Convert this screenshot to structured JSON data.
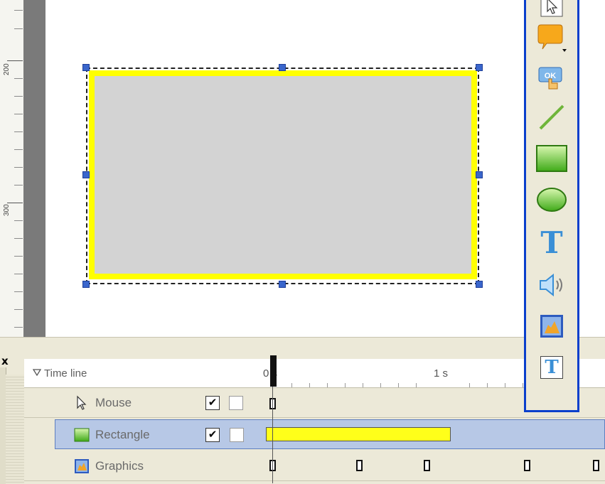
{
  "ruler": {
    "labels": [
      "200",
      "300"
    ]
  },
  "canvas": {
    "shape": {
      "fill": "#d3d3d3",
      "stroke": "#ffff00"
    },
    "handle_color": "#3a66cc"
  },
  "toolbox": {
    "border_color": "#0a3fcc",
    "tools": [
      {
        "name": "select",
        "icon": "arrow-pointer-icon"
      },
      {
        "name": "callout",
        "icon": "speech-bubble-icon"
      },
      {
        "name": "button",
        "icon": "ok-button-click-icon",
        "ok_text": "OK"
      },
      {
        "name": "line",
        "icon": "line-icon"
      },
      {
        "name": "rectangle",
        "icon": "rectangle-icon"
      },
      {
        "name": "ellipse",
        "icon": "ellipse-icon"
      },
      {
        "name": "text",
        "icon": "text-icon",
        "glyph": "T"
      },
      {
        "name": "audio",
        "icon": "speaker-icon"
      },
      {
        "name": "image",
        "icon": "image-icon"
      },
      {
        "name": "text-animation",
        "icon": "text-frame-icon",
        "glyph": "T"
      }
    ]
  },
  "timeline": {
    "close_glyph": "x",
    "header": {
      "label": "Time line"
    },
    "ruler": {
      "label_0": "0 s",
      "label_1": "1 s"
    },
    "rows": [
      {
        "label": "Mouse",
        "icon": "mouse-arrow-icon",
        "visible": true
      },
      {
        "label": "Rectangle",
        "icon": "rectangle-layer-icon",
        "visible": true,
        "selected": true,
        "bar_color": "#ffff1a"
      },
      {
        "label": "Graphics",
        "icon": "graphics-layer-icon"
      }
    ]
  }
}
